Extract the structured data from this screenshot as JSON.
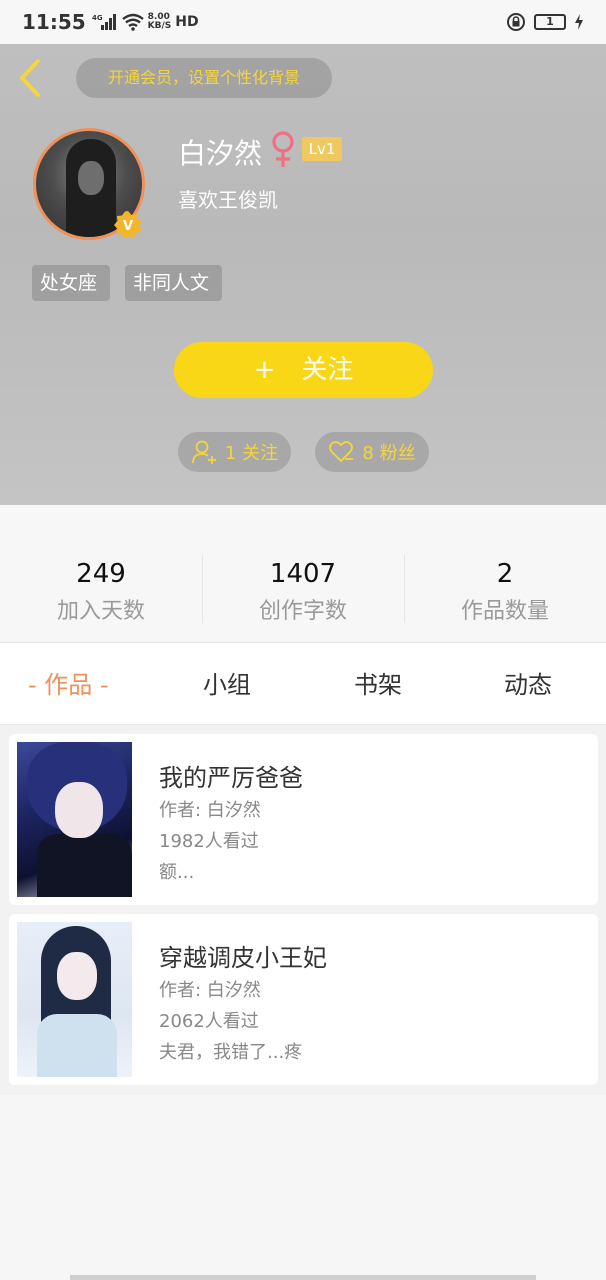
{
  "status_bar": {
    "time": "11:55",
    "network": "4G",
    "speed": "8.00",
    "speed_unit": "KB/S",
    "hd": "HD",
    "battery": "1"
  },
  "header": {
    "vip_prompt": "开通会员，设置个性化背景",
    "name": "白汐然",
    "level": "Lv1",
    "signature": "喜欢王俊凯",
    "tags": [
      "处女座",
      "非同人文"
    ],
    "follow_button": "关注",
    "follow_plus": "+",
    "following_count": "1 关注",
    "fans_count": "8 粉丝",
    "verified_letter": "V"
  },
  "stats": [
    {
      "value": "249",
      "label": "加入天数"
    },
    {
      "value": "1407",
      "label": "创作字数"
    },
    {
      "value": "2",
      "label": "作品数量"
    }
  ],
  "tabs": [
    {
      "label": "- 作品 -",
      "active": true
    },
    {
      "label": "小组"
    },
    {
      "label": "书架"
    },
    {
      "label": "动态"
    }
  ],
  "works": [
    {
      "title": "我的严厉爸爸",
      "author": "作者: 白汐然",
      "views": "1982人看过",
      "excerpt": "额..."
    },
    {
      "title": "穿越调皮小王妃",
      "author": "作者: 白汐然",
      "views": "2062人看过",
      "excerpt": "夫君，我错了...疼"
    }
  ],
  "colors": {
    "accent": "#f9d616",
    "tab_active": "#f0905a",
    "gold_text": "#f6d53c",
    "level_badge": "#f0c860"
  }
}
